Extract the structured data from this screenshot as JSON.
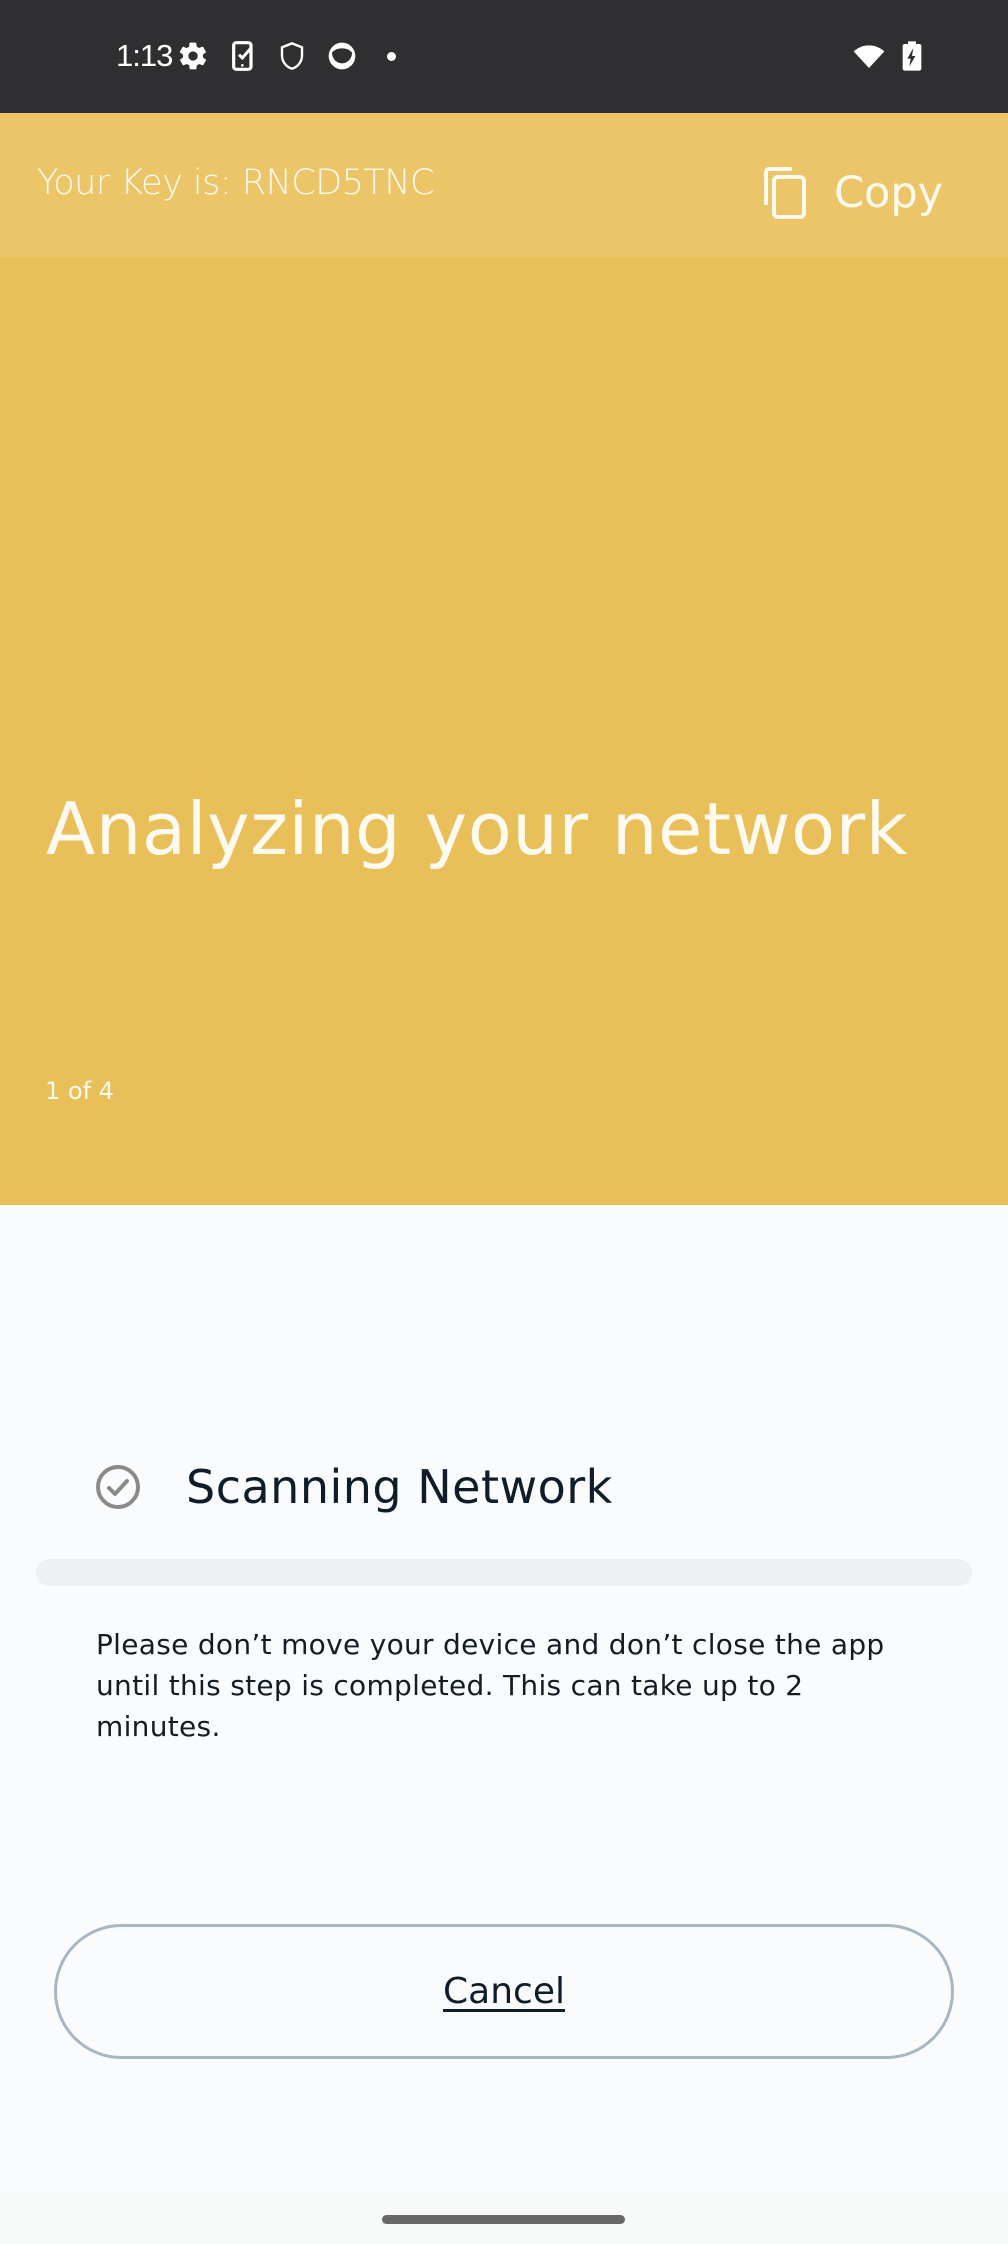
{
  "status_bar": {
    "time": "1:13",
    "left_icons": [
      "settings-gear-icon",
      "phone-check-icon",
      "shield-icon",
      "app-notification-icon",
      "more-dot-icon"
    ],
    "right_icons": [
      "wifi-icon",
      "battery-charging-icon"
    ]
  },
  "key_bar": {
    "key_label": "Your Key is: RNCD5TNC",
    "copy_label": "Copy",
    "copy_icon": "copy-icon"
  },
  "hero": {
    "title": "Analyzing your network",
    "step_indicator": "1 of 4"
  },
  "step": {
    "icon": "check-circle-icon",
    "title": "Scanning Network",
    "progress_percent": 0,
    "description": "Please don’t move your device and don’t close the app until this step is completed. This can take up to 2 minutes."
  },
  "actions": {
    "cancel_label": "Cancel"
  },
  "colors": {
    "accent": "#e8bf59",
    "key_bar_bg": "#ebc567",
    "status_bar_bg": "#2f2f31",
    "text_dark": "#0f1c2a",
    "progress_track": "#eef1f4",
    "button_border": "#a9b6c3"
  }
}
